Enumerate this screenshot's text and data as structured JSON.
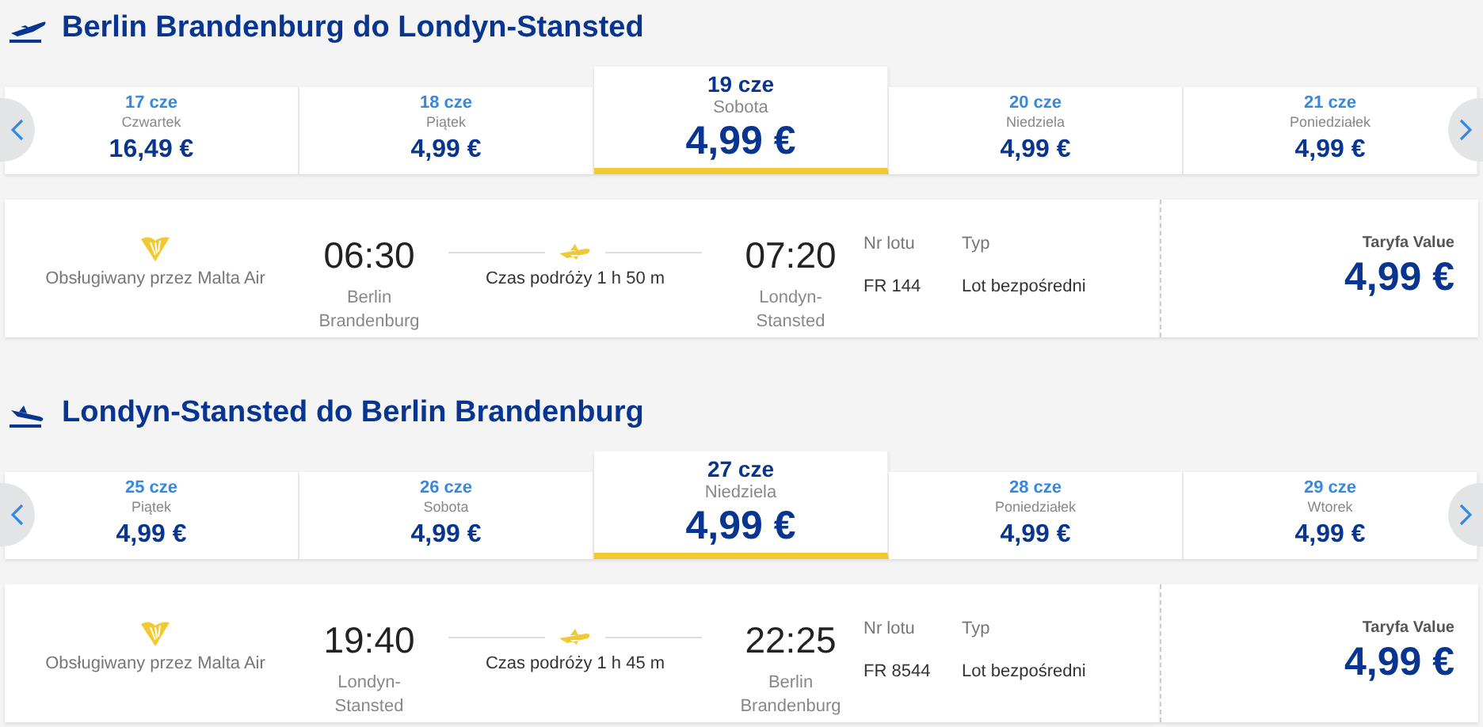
{
  "legs": [
    {
      "kind": "departure",
      "title": "Berlin Brandenburg do Londyn-Stansted",
      "dates": [
        {
          "date": "17 cze",
          "day": "Czwartek",
          "price": "16,49 €",
          "selected": false
        },
        {
          "date": "18 cze",
          "day": "Piątek",
          "price": "4,99 €",
          "selected": false
        },
        {
          "date": "19 cze",
          "day": "Sobota",
          "price": "4,99 €",
          "selected": true
        },
        {
          "date": "20 cze",
          "day": "Niedziela",
          "price": "4,99 €",
          "selected": false
        },
        {
          "date": "21 cze",
          "day": "Poniedziałek",
          "price": "4,99 €",
          "selected": false
        }
      ],
      "flight": {
        "operator": "Obsługiwany przez Malta Air",
        "depart_time": "06:30",
        "depart_airport": "Berlin Brandenburg",
        "duration": "Czas podróży 1 h 50 m",
        "arrive_time": "07:20",
        "arrive_airport": "Londyn-Stansted",
        "flight_no_label": "Nr lotu",
        "flight_no": "FR 144",
        "type_label": "Typ",
        "type": "Lot bezpośredni",
        "fare_label": "Taryfa Value",
        "fare": "4,99 €"
      }
    },
    {
      "kind": "return",
      "title": "Londyn-Stansted do Berlin Brandenburg",
      "dates": [
        {
          "date": "25 cze",
          "day": "Piątek",
          "price": "4,99 €",
          "selected": false
        },
        {
          "date": "26 cze",
          "day": "Sobota",
          "price": "4,99 €",
          "selected": false
        },
        {
          "date": "27 cze",
          "day": "Niedziela",
          "price": "4,99 €",
          "selected": true
        },
        {
          "date": "28 cze",
          "day": "Poniedziałek",
          "price": "4,99 €",
          "selected": false
        },
        {
          "date": "29 cze",
          "day": "Wtorek",
          "price": "4,99 €",
          "selected": false
        }
      ],
      "flight": {
        "operator": "Obsługiwany przez Malta Air",
        "depart_time": "19:40",
        "depart_airport": "Londyn-Stansted",
        "duration": "Czas podróży 1 h 45 m",
        "arrive_time": "22:25",
        "arrive_airport": "Berlin Brandenburg",
        "flight_no_label": "Nr lotu",
        "flight_no": "FR 8544",
        "type_label": "Typ",
        "type": "Lot bezpośredni",
        "fare_label": "Taryfa Value",
        "fare": "4,99 €"
      }
    }
  ]
}
